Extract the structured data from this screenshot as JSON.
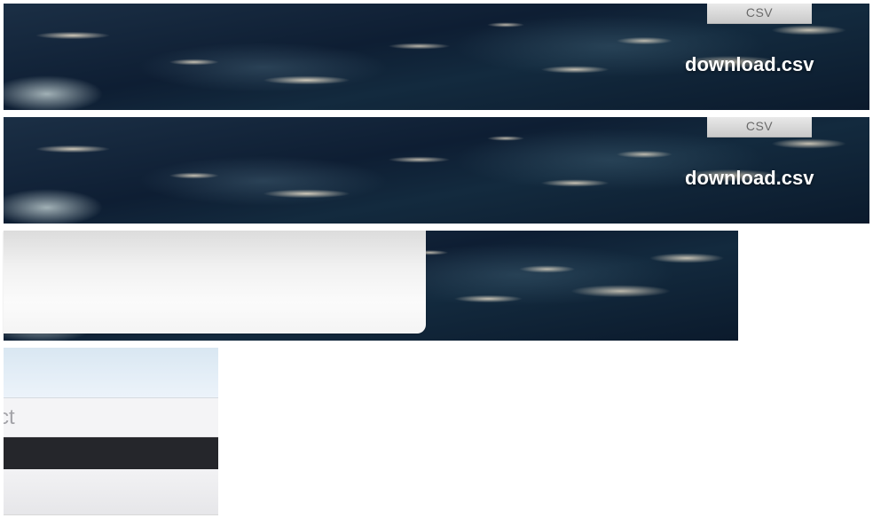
{
  "rows": [
    {
      "chip_label": "CSV",
      "download_label": "download.csv"
    },
    {
      "chip_label": "CSV",
      "download_label": "download.csv"
    }
  ],
  "mini_window": {
    "partial_text": "ct"
  },
  "colors": {
    "download_text": "#ffffff",
    "chip_bg": "#d9d9d9",
    "dark_bar": "#25262b"
  }
}
